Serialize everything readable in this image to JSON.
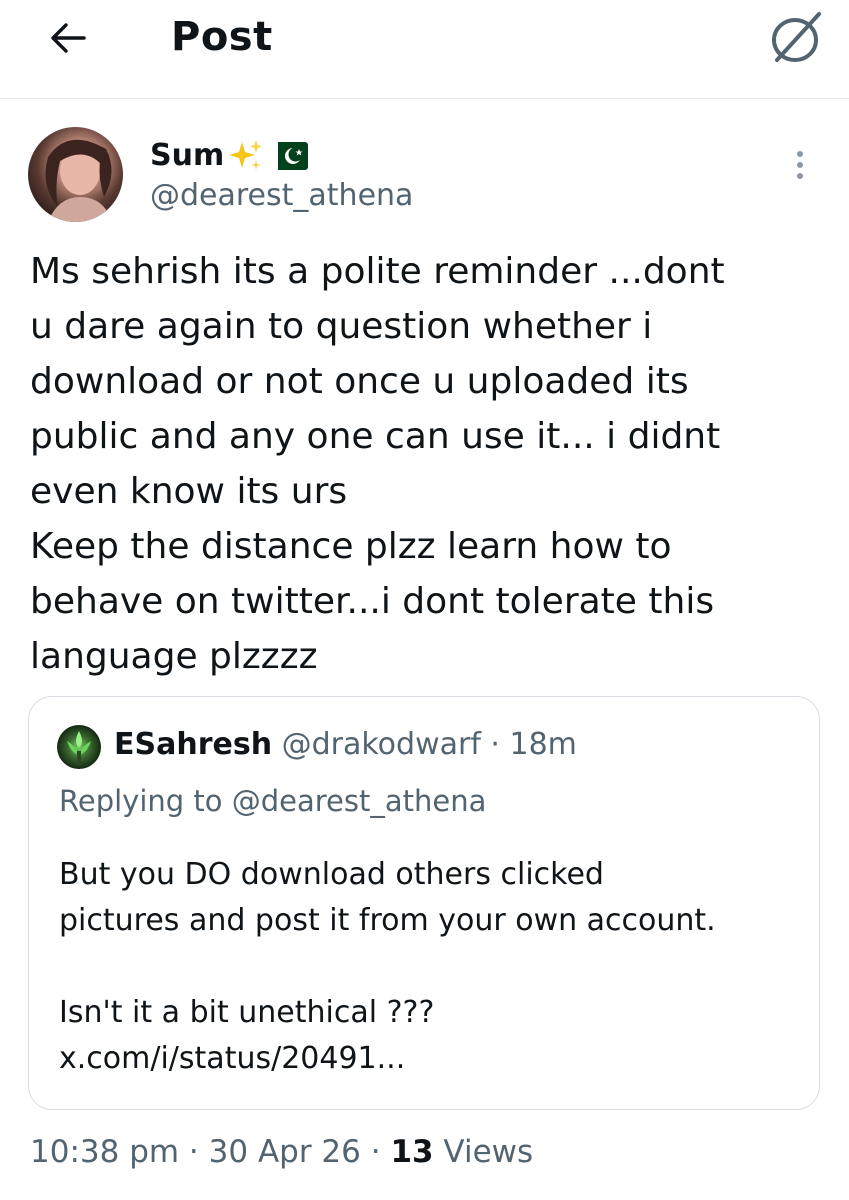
{
  "header": {
    "title": "Post",
    "back_icon": "arrow-left-icon",
    "right_icon": "x-slash-icon"
  },
  "author": {
    "name": "Sum",
    "name_emojis": [
      "sparkles-emoji",
      "pakistan-flag-emoji"
    ],
    "handle": "@dearest_athena",
    "more_icon": "more-vertical-icon"
  },
  "post": {
    "text": "Ms sehrish its a polite reminder ...dont\nu dare again to question whether i\ndownload or not once u uploaded its\npublic and any one can use it... i didnt\neven know its urs\nKeep the distance plzz learn how to\nbehave on twitter...i dont tolerate this\nlanguage plzzzz"
  },
  "quote": {
    "name": "ESahresh",
    "handle": "@drakodwarf",
    "separator": " · ",
    "time": "18m",
    "replying_to": "Replying to @dearest_athena",
    "text": "But you DO download others  clicked\npictures and post it from your own account.\n\nIsn't it a bit unethical ???\nx.com/i/status/20491..."
  },
  "meta": {
    "time": "10:38 pm",
    "separator": " · ",
    "date": "30 Apr 26",
    "views_count": "13",
    "views_label": " Views"
  },
  "colors": {
    "text_primary": "#0f1419",
    "text_secondary": "#536471",
    "border": "#d8dee3",
    "flag_green": "#01411c"
  }
}
